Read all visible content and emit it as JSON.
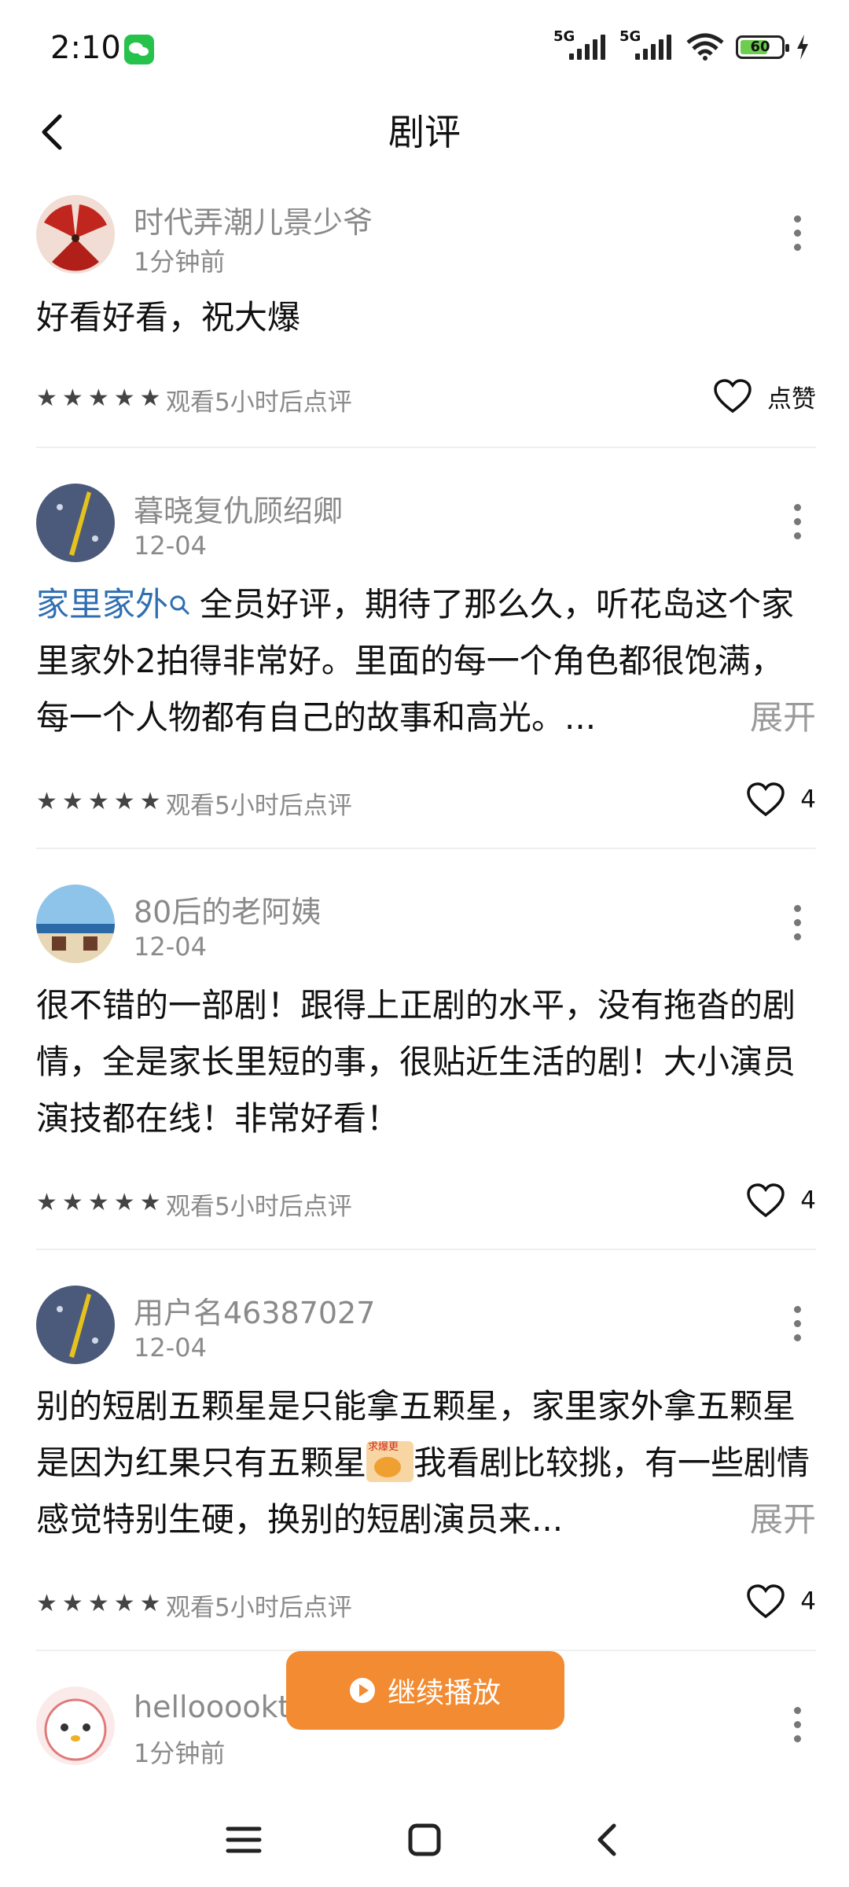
{
  "status_bar": {
    "time": "2:10",
    "battery": "60",
    "signal1": "5G",
    "signal2": "5G"
  },
  "header": {
    "title": "剧评"
  },
  "comments": [
    {
      "username": "时代弄潮儿景少爷",
      "time": "1分钟前",
      "text": "好看好看，祝大爆",
      "rating": 5,
      "meta": "观看5小时后点评",
      "like_label": "点赞"
    },
    {
      "username": "暮晓复仇顾绍卿",
      "time": "12-04",
      "keyword": "家里家外",
      "text": "全员好评，期待了那么久，听花岛这个家里家外2拍得非常好。里面的每一个角色都很饱满，每一个人物都有自己的故事和高光。...",
      "expand": "展开",
      "rating": 5,
      "meta": "观看5小时后点评",
      "like_count": "4"
    },
    {
      "username": "80后的老阿姨",
      "time": "12-04",
      "text": "很不错的一部剧！跟得上正剧的水平，没有拖沓的剧情，全是家长里短的事，很贴近生活的剧！大小演员演技都在线！非常好看！",
      "rating": 5,
      "meta": "观看5小时后点评",
      "like_count": "4"
    },
    {
      "username": "用户名46387027",
      "time": "12-04",
      "text_a": "别的短剧五颗星是只能拿五颗星，家里家外拿五颗星是因为红果只有五颗星",
      "sticker_text": "求爆更",
      "text_b": "我看剧比较挑，有一些剧情感觉特别生硬，换别的短剧演员来...",
      "expand": "展开",
      "rating": 5,
      "meta": "观看5小时后点评",
      "like_count": "4"
    },
    {
      "username": "hellooookt",
      "time": "1分钟前"
    }
  ],
  "fab": {
    "label": "继续播放"
  },
  "icons": {
    "back": "back-arrow-icon",
    "more": "more-vertical-icon",
    "heart": "heart-outline-icon",
    "star": "star-icon",
    "search": "search-icon",
    "menu": "menu-icon",
    "home": "home-square-icon",
    "nav_back": "nav-back-icon"
  },
  "colors": {
    "accent": "#f28b32",
    "link": "#2f6fb1",
    "muted": "#8a8a8a"
  }
}
